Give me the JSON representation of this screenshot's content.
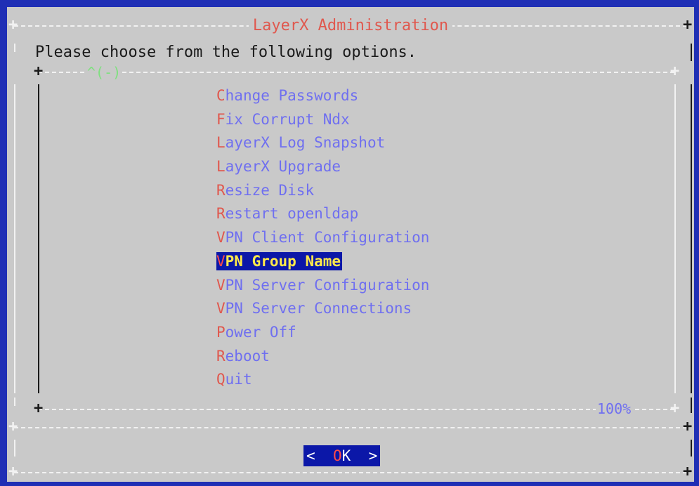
{
  "dialog": {
    "title": "LayerX Administration",
    "prompt": "Please choose from the following options."
  },
  "menu": {
    "scroll_indicator": "^(-)",
    "scroll_percent": "100%",
    "selected_index": 7,
    "items": [
      {
        "hotkey": "C",
        "rest": "hange Passwords"
      },
      {
        "hotkey": "F",
        "rest": "ix Corrupt Ndx"
      },
      {
        "hotkey": "L",
        "rest": "ayerX Log Snapshot"
      },
      {
        "hotkey": "L",
        "rest": "ayerX Upgrade"
      },
      {
        "hotkey": "R",
        "rest": "esize Disk"
      },
      {
        "hotkey": "R",
        "rest": "estart openldap"
      },
      {
        "hotkey": "V",
        "rest": "PN Client Configuration"
      },
      {
        "hotkey": "V",
        "rest": "PN Group Name"
      },
      {
        "hotkey": "V",
        "rest": "PN Server Configuration"
      },
      {
        "hotkey": "V",
        "rest": "PN Server Connections"
      },
      {
        "hotkey": "P",
        "rest": "ower Off"
      },
      {
        "hotkey": "R",
        "rest": "eboot"
      },
      {
        "hotkey": "Q",
        "rest": "uit"
      }
    ]
  },
  "buttons": {
    "ok": {
      "left": "<",
      "hotkey": "O",
      "rest": "K",
      "right": ">"
    }
  },
  "colors": {
    "background": "#1f2fb5",
    "dialog": "#c9c9c9",
    "hotkey": "#e0584e",
    "item_text": "#6f6ff0",
    "selected_bg": "#0b17a8",
    "selected_text": "#ffe94a"
  }
}
